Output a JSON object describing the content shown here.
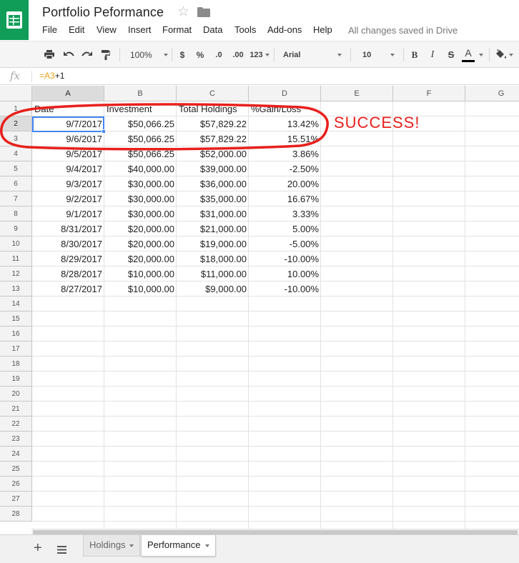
{
  "app": {
    "name": "Google Sheets",
    "logo_icon": "sheets-logo-icon",
    "brand_color": "#0f9d58"
  },
  "document": {
    "title": "Portfolio Peformance",
    "save_status": "All changes saved in Drive"
  },
  "menu": [
    "File",
    "Edit",
    "View",
    "Insert",
    "Format",
    "Data",
    "Tools",
    "Add-ons",
    "Help"
  ],
  "toolbar": {
    "zoom": "100%",
    "currency": "$",
    "percent": "%",
    "decrease_decimals": ".0",
    "increase_decimals": ".00",
    "more_formats": "123",
    "font": "Arial",
    "font_size": "10",
    "bold": "B",
    "italic": "I",
    "strikethrough": "S",
    "text_color_label": "A",
    "text_color": "#000000"
  },
  "formula_bar": {
    "icon": "fx",
    "ref": "=A3",
    "rest": "+1"
  },
  "grid": {
    "columns": [
      "A",
      "B",
      "C",
      "D",
      "E",
      "F",
      "G"
    ],
    "selected_column": "A",
    "selected_row": "2",
    "row_numbers": [
      "1",
      "2",
      "3",
      "4",
      "5",
      "6",
      "7",
      "8",
      "9",
      "10",
      "11",
      "12",
      "13",
      "14",
      "15",
      "16",
      "17",
      "18",
      "19",
      "20",
      "21",
      "22",
      "23",
      "24",
      "25",
      "26",
      "27",
      "28"
    ],
    "headers": [
      "Date",
      "Investment",
      "Total Holdings",
      "%Gain/Loss"
    ],
    "rows": [
      [
        "9/7/2017",
        "$50,066.25",
        "$57,829.22",
        "13.42%"
      ],
      [
        "9/6/2017",
        "$50,066.25",
        "$57,829.22",
        "15.51%"
      ],
      [
        "9/5/2017",
        "$50,066.25",
        "$52,000.00",
        "3.86%"
      ],
      [
        "9/4/2017",
        "$40,000.00",
        "$39,000.00",
        "-2.50%"
      ],
      [
        "9/3/2017",
        "$30,000.00",
        "$36,000.00",
        "20.00%"
      ],
      [
        "9/2/2017",
        "$30,000.00",
        "$35,000.00",
        "16.67%"
      ],
      [
        "9/1/2017",
        "$30,000.00",
        "$31,000.00",
        "3.33%"
      ],
      [
        "8/31/2017",
        "$20,000.00",
        "$21,000.00",
        "5.00%"
      ],
      [
        "8/30/2017",
        "$20,000.00",
        "$19,000.00",
        "-5.00%"
      ],
      [
        "8/29/2017",
        "$20,000.00",
        "$18,000.00",
        "-10.00%"
      ],
      [
        "8/28/2017",
        "$10,000.00",
        "$11,000.00",
        "10.00%"
      ],
      [
        "8/27/2017",
        "$10,000.00",
        "$9,000.00",
        "-10.00%"
      ]
    ]
  },
  "annotation": {
    "text": "SUCCESS!",
    "color": "#e8201c"
  },
  "sheets": {
    "tabs": [
      {
        "label": "Holdings",
        "active": false
      },
      {
        "label": "Performance",
        "active": true
      }
    ]
  },
  "accent_color": "#4285f4"
}
